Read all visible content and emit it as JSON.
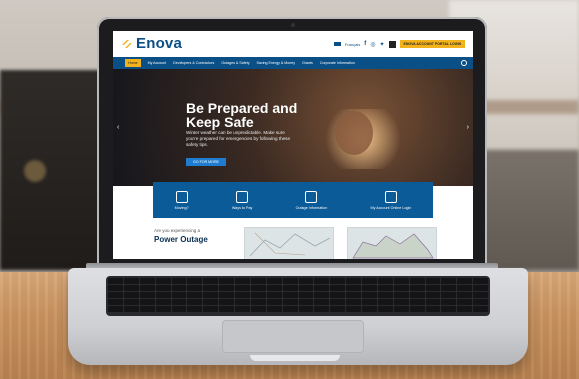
{
  "site": {
    "logo": "Enova",
    "utility": {
      "lang": "Français",
      "cta": "ENOVA ACCOUNT PORTAL LOGIN"
    },
    "nav": [
      "Home",
      "My Account",
      "Developers & Contractors",
      "Outages & Safety",
      "Saving Energy & Money",
      "Grants",
      "Corporate Information"
    ],
    "hero": {
      "title": "Be Prepared and Keep Safe",
      "body": "Winter weather can be unpredictable. Make sure you're prepared for emergencies by following these safety tips.",
      "button": "GO FOR MORE"
    },
    "quick_links": [
      "Moving?",
      "Ways to Pay",
      "Outage Information",
      "My Account Online Login"
    ],
    "outage": {
      "small": "Are you experiencing a",
      "big": "Power Outage"
    }
  },
  "colors": {
    "brand": "#0a4f86",
    "accent": "#f2b21b"
  }
}
